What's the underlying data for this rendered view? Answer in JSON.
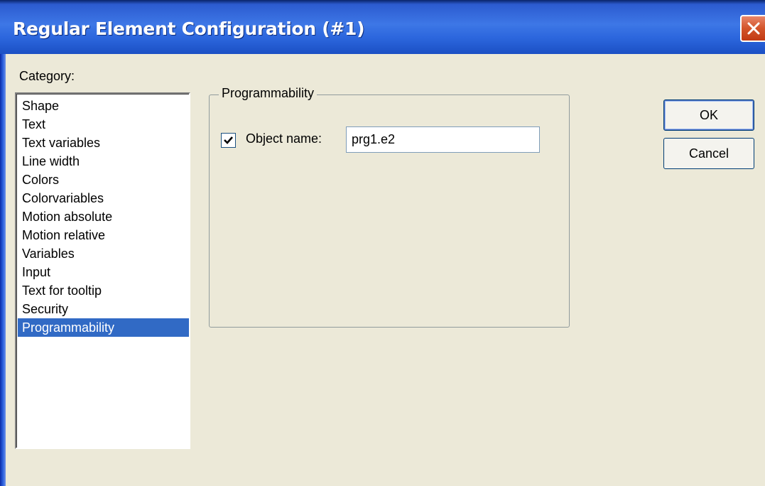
{
  "window": {
    "title": "Regular Element Configuration (#1)"
  },
  "category": {
    "label": "Category:",
    "items": [
      {
        "label": "Shape"
      },
      {
        "label": "Text"
      },
      {
        "label": "Text variables"
      },
      {
        "label": "Line width"
      },
      {
        "label": "Colors"
      },
      {
        "label": "Colorvariables"
      },
      {
        "label": "Motion absolute"
      },
      {
        "label": "Motion relative"
      },
      {
        "label": "Variables"
      },
      {
        "label": "Input"
      },
      {
        "label": "Text for tooltip"
      },
      {
        "label": "Security"
      },
      {
        "label": "Programmability"
      }
    ],
    "selected": "Programmability"
  },
  "panel": {
    "group_title": "Programmability",
    "object_name_label": "Object name:",
    "object_name_checked": true,
    "object_name_value": "prg1.e2"
  },
  "buttons": {
    "ok": "OK",
    "cancel": "Cancel"
  },
  "colors": {
    "selection": "#316ac5",
    "titlebar": "#2c66dd",
    "close": "#d3542a",
    "dialog_bg": "#ece9d8"
  },
  "icons": {
    "close": "close-icon",
    "check": "check-icon"
  }
}
